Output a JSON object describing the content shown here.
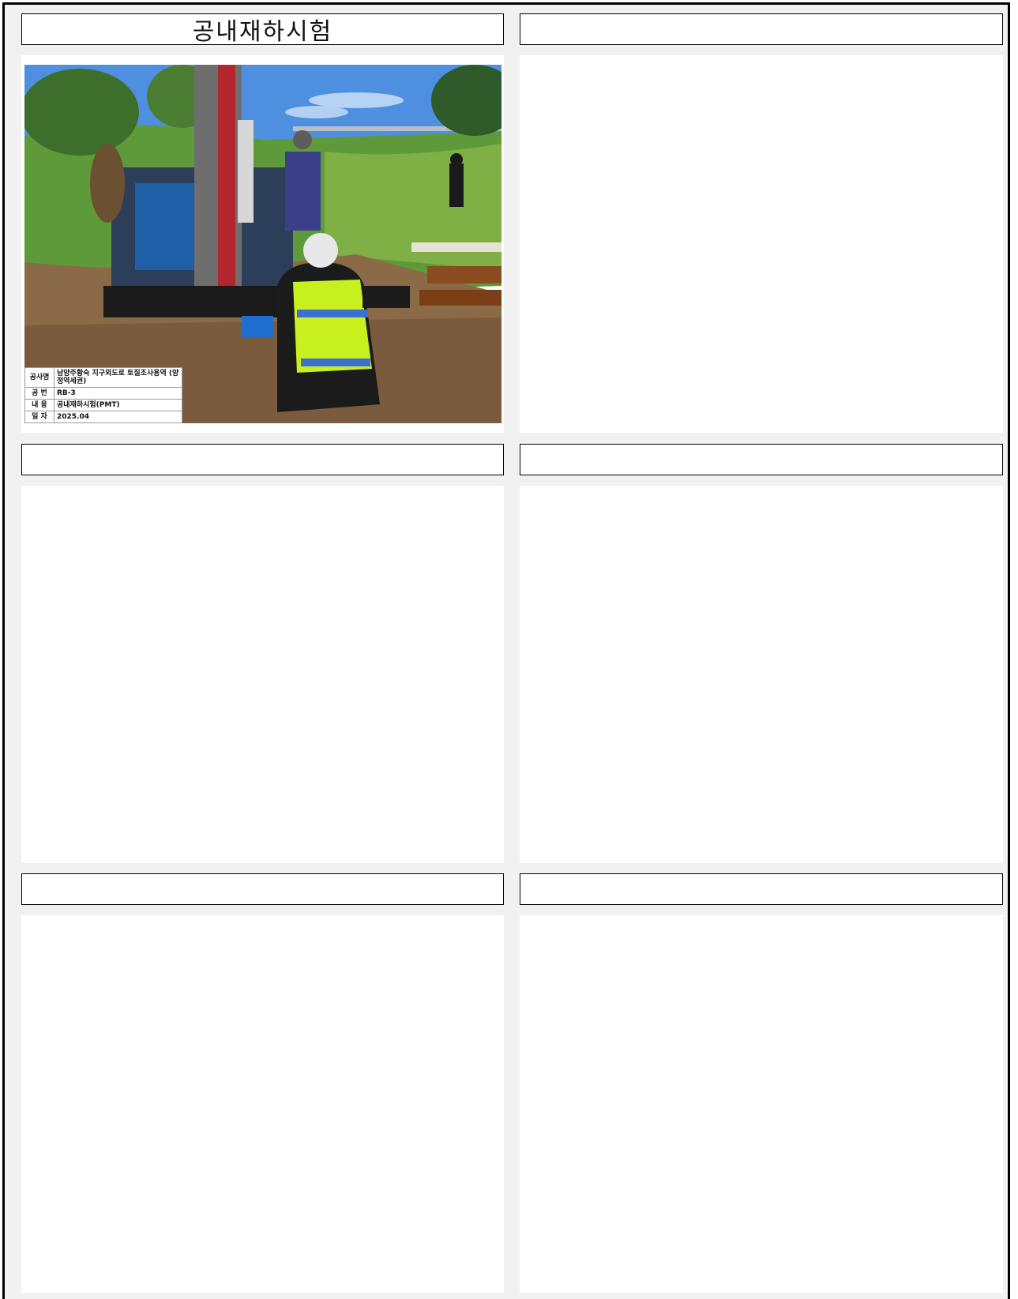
{
  "panels": [
    {
      "title": "공내재하시험",
      "has_photo": true
    },
    {
      "title": "",
      "has_photo": false
    },
    {
      "title": "",
      "has_photo": false
    },
    {
      "title": "",
      "has_photo": false
    },
    {
      "title": "",
      "has_photo": false
    },
    {
      "title": "",
      "has_photo": false
    }
  ],
  "photo": {
    "caption": [
      {
        "key": "공사명",
        "value": "남양주황숙 지구외도로 토질조사용역 (양정역세권)"
      },
      {
        "key": "공 번",
        "value": "RB-3"
      },
      {
        "key": "내 용",
        "value": "공내재하시험(PMT)"
      },
      {
        "key": "일 자",
        "value": "2025.04"
      }
    ]
  },
  "colors": {
    "frame": "#000000",
    "background": "#f1f1f1",
    "sky": "#4f8fe0",
    "grass": "#5f9a3a",
    "vest": "#c8f01e"
  }
}
